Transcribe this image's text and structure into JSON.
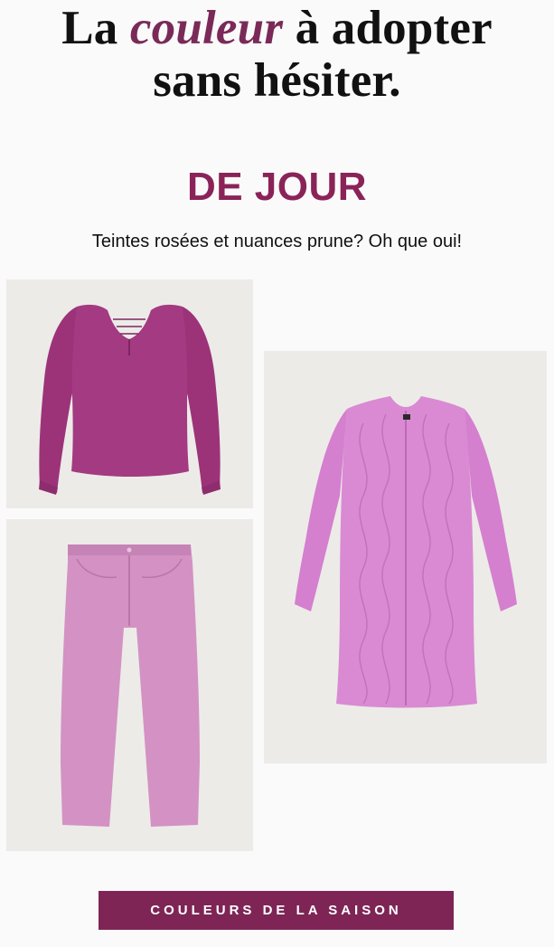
{
  "headline": {
    "before": "La ",
    "accent": "couleur",
    "after": " à adopter",
    "line2": "sans hésiter."
  },
  "section": {
    "title": "DE JOUR",
    "subtitle": "Teintes rosées et nuances prune? Oh que oui!"
  },
  "products": [
    {
      "name": "blouse-magenta",
      "color": "#a33a82"
    },
    {
      "name": "jean-rose",
      "color": "#d392c3"
    },
    {
      "name": "manteau-matelasse",
      "color": "#d98ad3"
    }
  ],
  "cta": {
    "label": "COULEURS DE LA SAISON"
  },
  "colors": {
    "accent": "#8a2358",
    "button": "#7e2556",
    "tile": "#ecebe8"
  }
}
